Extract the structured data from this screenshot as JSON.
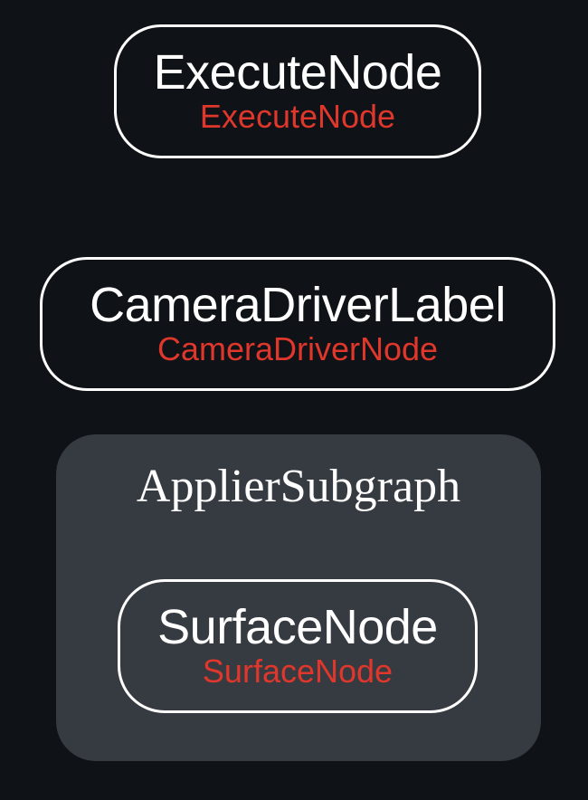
{
  "colors": {
    "background": "#0f1216",
    "node_border": "#ffffff",
    "node_title": "#ffffff",
    "node_subtitle": "#e0372c",
    "subgraph_fill": "#363a41"
  },
  "nodes": {
    "execute": {
      "title": "ExecuteNode",
      "subtitle": "ExecuteNode"
    },
    "camera": {
      "title": "CameraDriverLabel",
      "subtitle": "CameraDriverNode"
    }
  },
  "subgraph": {
    "title": "ApplierSubgraph",
    "nodes": {
      "surface": {
        "title": "SurfaceNode",
        "subtitle": "SurfaceNode"
      }
    }
  }
}
